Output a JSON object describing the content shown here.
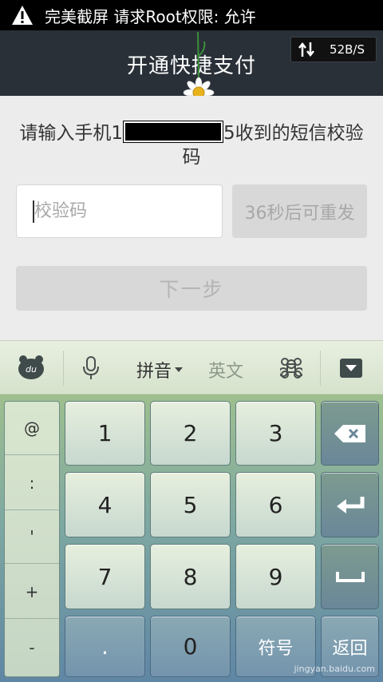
{
  "status_bar": {
    "notification_text": "完美截屏 请求Root权限: 允许",
    "icon": "warning-icon"
  },
  "title_bar": {
    "title": "开通快捷支付",
    "net_speed": "52B/S",
    "net_icon": "updown-arrows-icon"
  },
  "content": {
    "prompt_before": "请输入手机1",
    "prompt_after": "5收到的短信校验码",
    "code_placeholder": "校验码",
    "resend_label": "36秒后可重发",
    "next_label": "下一步"
  },
  "keyboard": {
    "toolbar": {
      "mode_pinyin": "拼音",
      "mode_english": "英文",
      "icons": [
        "du-logo-icon",
        "microphone-icon",
        "command-icon",
        "hide-keyboard-icon"
      ]
    },
    "side_symbols": [
      "@",
      ":",
      "'",
      "+",
      "-"
    ],
    "keys_row1": [
      "1",
      "2",
      "3"
    ],
    "keys_row2": [
      "4",
      "5",
      "6"
    ],
    "keys_row3": [
      "7",
      "8",
      "9"
    ],
    "key_dot": ".",
    "key_zero": "0",
    "key_symbols": "符号",
    "key_back": "返回"
  },
  "watermark": "jingyan.baidu.com",
  "colors": {
    "title_bg": "#2a3038",
    "content_bg": "#ececec",
    "keyboard_top": "#9ebf8e",
    "keyboard_bottom": "#5f86a4"
  }
}
